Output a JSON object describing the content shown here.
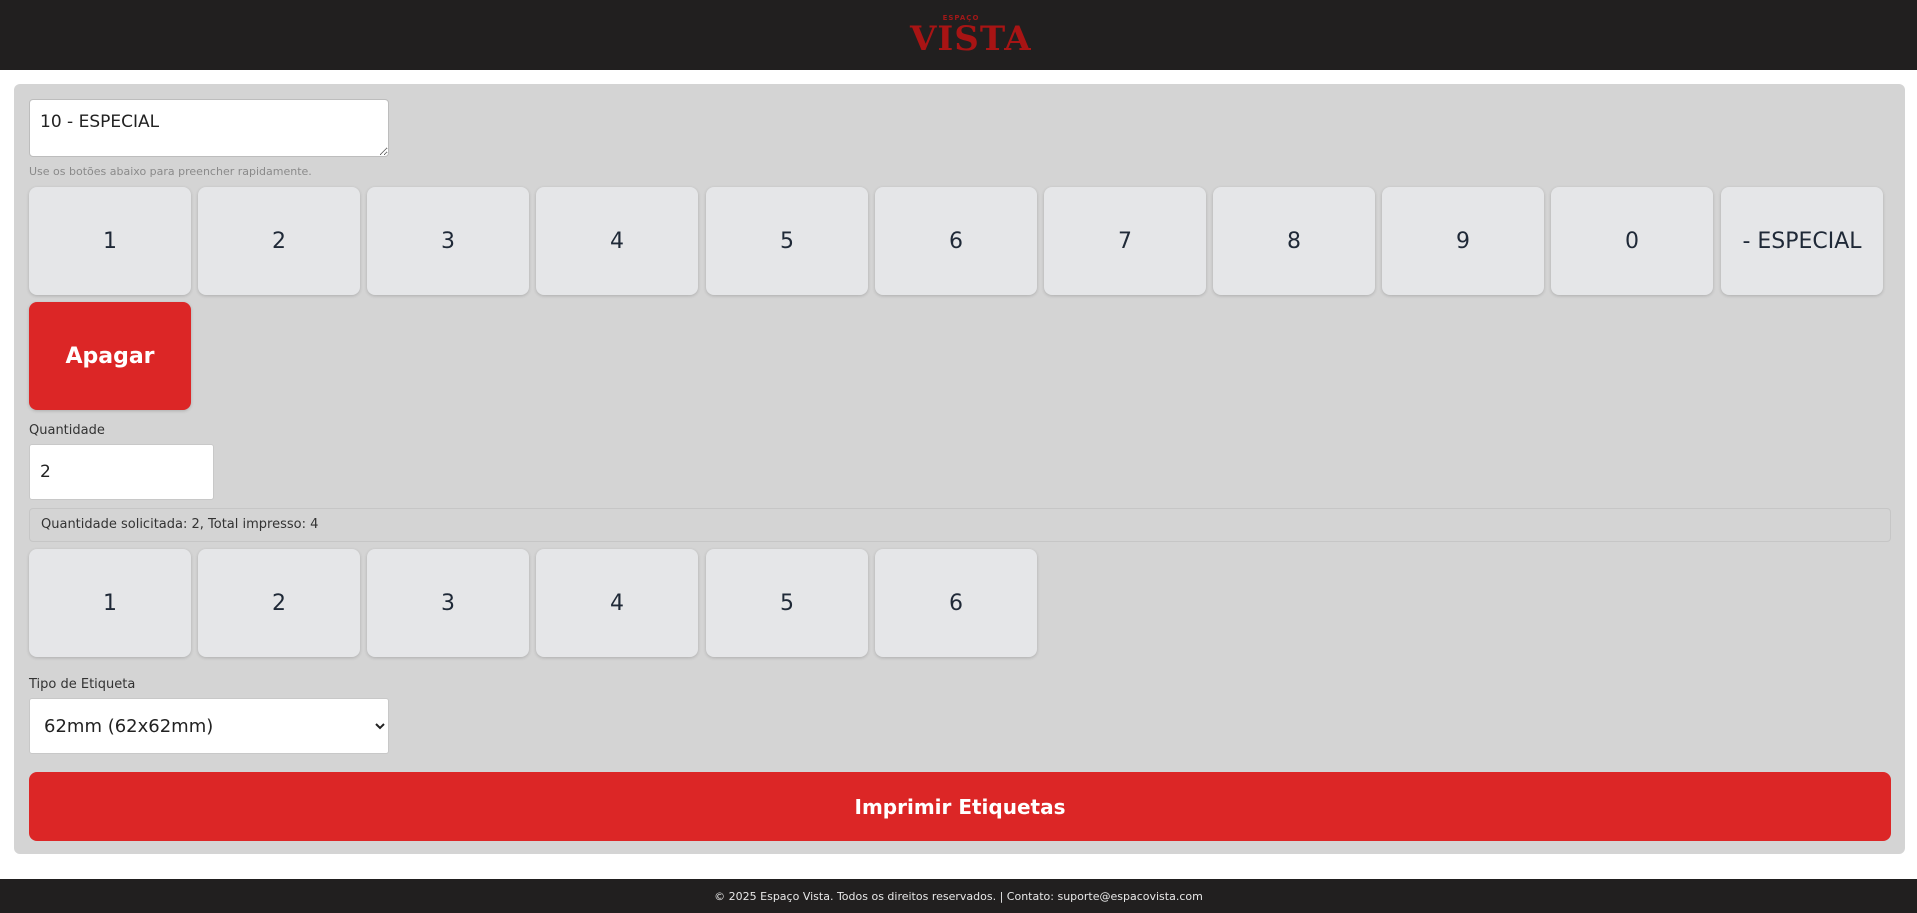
{
  "header": {
    "logo_small": "ESPAÇO",
    "logo_big": "VISTA",
    "logo_color": "#a81414"
  },
  "form": {
    "code_value": "10 - ESPECIAL",
    "hint": "Use os botões abaixo para preencher rapidamente.",
    "code_keys": [
      "1",
      "2",
      "3",
      "4",
      "5",
      "6",
      "7",
      "8",
      "9",
      "0",
      "- ESPECIAL"
    ],
    "clear_label": "Apagar",
    "quantity_label": "Quantidade",
    "quantity_value": "2",
    "status_text": "Quantidade solicitada: 2, Total impresso: 4",
    "quantity_keys": [
      "1",
      "2",
      "3",
      "4",
      "5",
      "6"
    ],
    "label_type_label": "Tipo de Etiqueta",
    "label_type_selected": "62mm (62x62mm)",
    "print_label": "Imprimir Etiquetas"
  },
  "colors": {
    "accent": "#dc2626",
    "dark": "#211f1f",
    "panel": "#d4d4d4",
    "key": "#e5e6e8"
  },
  "footer": {
    "text": "© 2025 Espaço Vista. Todos os direitos reservados. | Contato: suporte@espacovista.com"
  }
}
